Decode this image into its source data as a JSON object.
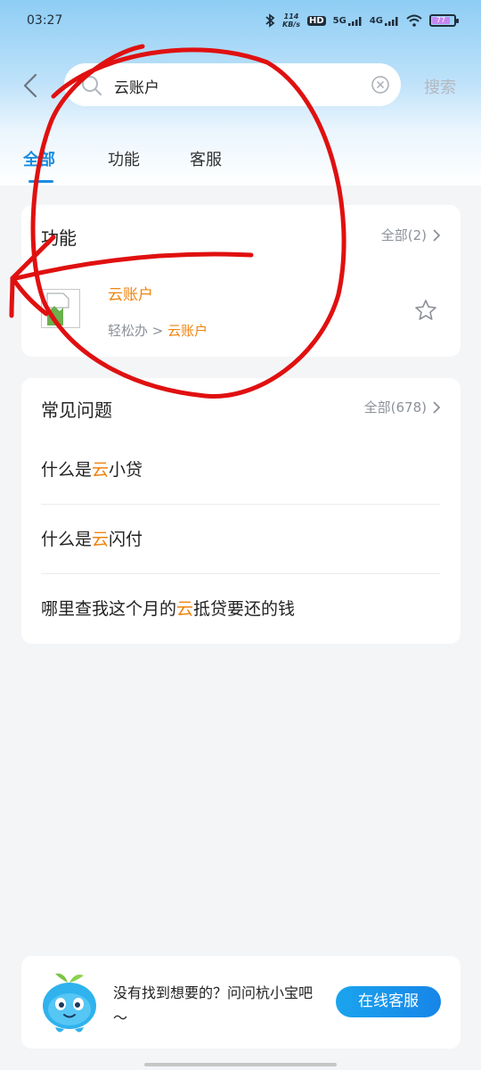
{
  "status_bar": {
    "time": "03:27",
    "net_speed_top": "114",
    "net_speed_bottom": "KB/s",
    "hd": "HD",
    "sim1": "5G",
    "sim2": "4G",
    "battery": "77"
  },
  "search": {
    "query": "云账户",
    "submit_label": "搜索"
  },
  "tabs": [
    {
      "label": "全部",
      "active": true
    },
    {
      "label": "功能",
      "active": false
    },
    {
      "label": "客服",
      "active": false
    }
  ],
  "functions_section": {
    "title": "功能",
    "more_label": "全部(2)",
    "items": [
      {
        "name": "云账户",
        "path_prefix": "轻松办 > ",
        "path_highlight": "云账户"
      }
    ]
  },
  "faq_section": {
    "title": "常见问题",
    "more_label": "全部(678)",
    "items": [
      {
        "before": "什么是",
        "highlight": "云",
        "after": "小贷"
      },
      {
        "before": "什么是",
        "highlight": "云",
        "after": "闪付"
      },
      {
        "before": "哪里查我这个月的",
        "highlight": "云",
        "after": "抵贷要还的钱"
      }
    ]
  },
  "assistant": {
    "text": "没有找到想要的？问问杭小宝吧～",
    "button_label": "在线客服"
  },
  "colors": {
    "accent_blue": "#1a8ce0",
    "highlight_orange": "#f0830e",
    "annotation_red": "#e01010"
  },
  "icons": [
    "back-icon",
    "search-icon",
    "clear-icon",
    "chevron-right-icon",
    "star-icon",
    "bluetooth-icon",
    "wifi-icon",
    "battery-icon",
    "mascot-icon"
  ]
}
